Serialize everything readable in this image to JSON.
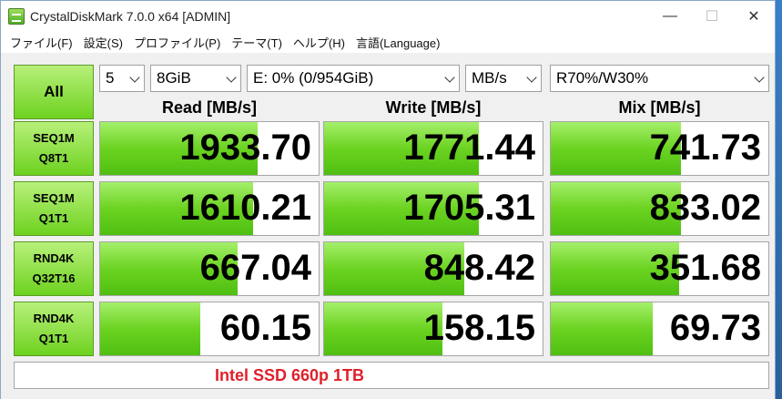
{
  "window": {
    "title": "CrystalDiskMark 7.0.0 x64 [ADMIN]",
    "controls": [
      "—",
      "☐",
      "✕"
    ]
  },
  "menu": [
    "ファイル(F)",
    "設定(S)",
    "プロファイル(P)",
    "テーマ(T)",
    "ヘルプ(H)",
    "言語(Language)"
  ],
  "toolbar": {
    "all_label": "All",
    "count": "5",
    "size": "8GiB",
    "drive": "E: 0% (0/954GiB)",
    "unit": "MB/s",
    "mix": "R70%/W30%"
  },
  "columns": [
    "Read [MB/s]",
    "Write [MB/s]",
    "Mix [MB/s]"
  ],
  "colors": {
    "bar_top": "#a4f06a",
    "bar_mid": "#6cd321",
    "comment": "#e0202a"
  },
  "tests": [
    {
      "line1": "SEQ1M",
      "line2": "Q8T1",
      "read": "1933.70",
      "write": "1771.44",
      "mix": "741.73",
      "read_fill": 0.72,
      "write_fill": 0.71,
      "mix_fill": 0.6
    },
    {
      "line1": "SEQ1M",
      "line2": "Q1T1",
      "read": "1610.21",
      "write": "1705.31",
      "mix": "833.02",
      "read_fill": 0.7,
      "write_fill": 0.71,
      "mix_fill": 0.6
    },
    {
      "line1": "RND4K",
      "line2": "Q32T16",
      "read": "667.04",
      "write": "848.42",
      "mix": "351.68",
      "read_fill": 0.63,
      "write_fill": 0.64,
      "mix_fill": 0.59
    },
    {
      "line1": "RND4K",
      "line2": "Q1T1",
      "read": "60.15",
      "write": "158.15",
      "mix": "69.73",
      "read_fill": 0.46,
      "write_fill": 0.54,
      "mix_fill": 0.47
    }
  ],
  "comment": "Intel SSD 660p 1TB"
}
